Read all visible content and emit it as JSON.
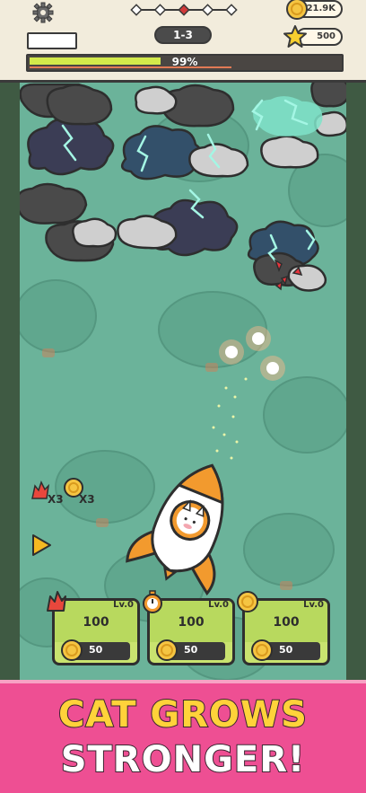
{
  "hud": {
    "stage": "1-3",
    "coins": "21.9K",
    "stars": "500",
    "progress_text": "99%",
    "progress_fraction": 0.99,
    "stage_nodes": 5,
    "current_node": 2
  },
  "boosts": {
    "fire_multiplier": "X3",
    "coin_multiplier": "X3"
  },
  "upgrades": [
    {
      "icon": "fire-icon",
      "level": "Lv.0",
      "value": "100",
      "cost": "50"
    },
    {
      "icon": "stopwatch-icon",
      "level": "Lv.0",
      "value": "100",
      "cost": "50"
    },
    {
      "icon": "coin-icon",
      "level": "Lv.0",
      "value": "100",
      "cost": "50"
    }
  ],
  "banner": {
    "line1": "CAT GROWS",
    "line2": "STRONGER!"
  },
  "colors": {
    "field": "#6bb39a",
    "banner": "#ee4f93",
    "card": "#c9e36f",
    "progress_fill": "#d3e94b",
    "headline_yellow": "#ffd23a"
  }
}
